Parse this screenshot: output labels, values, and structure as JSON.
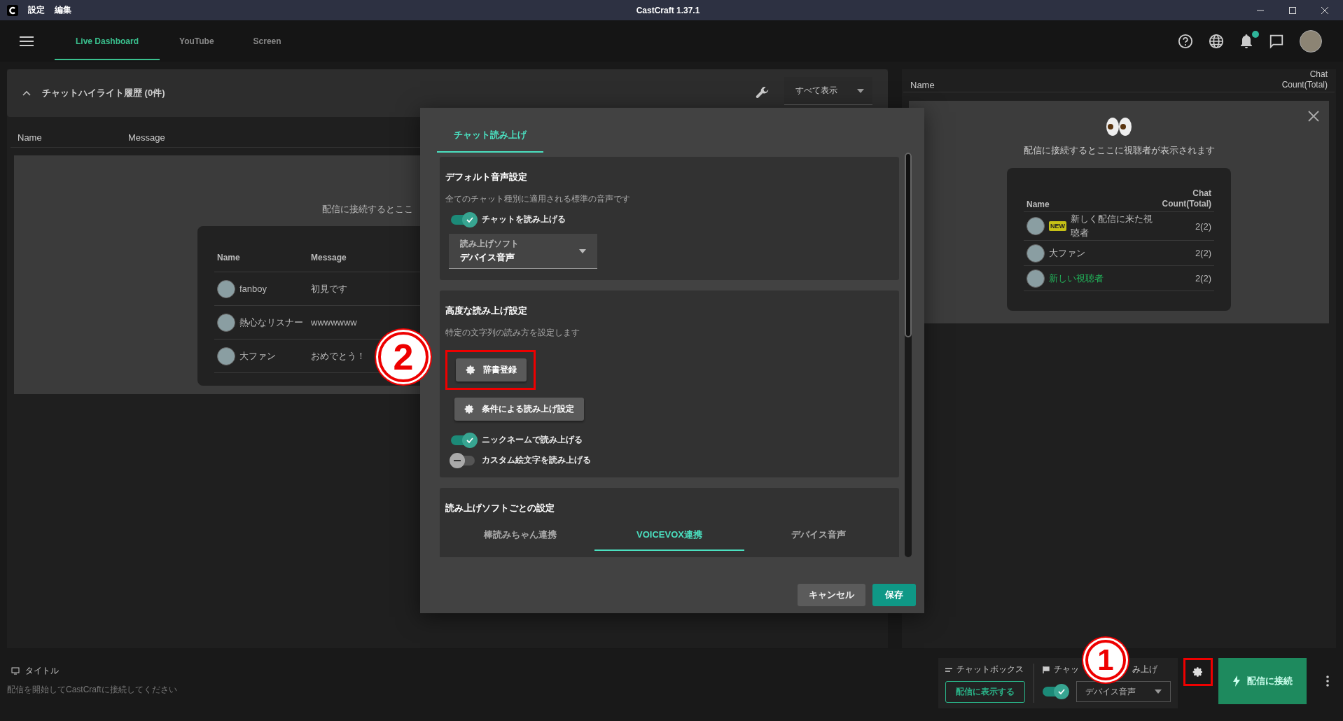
{
  "window": {
    "app_menu": [
      "設定",
      "編集"
    ],
    "title": "CastCraft 1.37.1"
  },
  "nav": {
    "tabs": [
      {
        "label": "Live Dashboard",
        "selected": true
      },
      {
        "label": "YouTube",
        "selected": false
      },
      {
        "label": "Screen",
        "selected": false
      }
    ],
    "notification_badge": true
  },
  "highlights": {
    "title": "チャットハイライト履歴 (0件)",
    "expanded": true,
    "filter": "すべて表示",
    "columns": [
      "Name",
      "Message"
    ],
    "empty_message": "配信に接続するとここ",
    "sample": {
      "columns": [
        "Name",
        "Message"
      ],
      "rows": [
        {
          "name": "fanboy",
          "message": "初見です"
        },
        {
          "name": "熱心なリスナー",
          "message": "wwwwwww"
        },
        {
          "name": "大ファン",
          "message": "おめでとう！"
        }
      ]
    }
  },
  "viewers": {
    "columns": [
      "Name",
      "Chat Count(Total)"
    ],
    "empty_message": "配信に接続するとここに視聴者が表示されます",
    "sample": {
      "columns": [
        "Name",
        "Chat Count(Total)"
      ],
      "rows": [
        {
          "name": "新しく配信に来た視聴者",
          "badge": "NEW",
          "highlighted": false,
          "count": "2(2)"
        },
        {
          "name": "大ファン",
          "highlighted": false,
          "count": "2(2)"
        },
        {
          "name": "新しい視聴者",
          "highlighted": true,
          "count": "2(2)"
        }
      ]
    }
  },
  "dialog": {
    "tabs": [
      {
        "label": "チャット読み上げ",
        "selected": true
      }
    ],
    "sections": [
      {
        "title": "デフォルト音声設定",
        "description": "全てのチャット種別に適用される標準の音声です",
        "items": [
          {
            "kind": "toggle",
            "label": "チャットを読み上げる",
            "on": true
          },
          {
            "kind": "select",
            "label": "読み上げソフト",
            "value": "デバイス音声"
          }
        ]
      },
      {
        "title": "高度な読み上げ設定",
        "description": "特定の文字列の読み方を設定します",
        "items": [
          {
            "kind": "button",
            "label": "辞書登録",
            "annotated": true
          },
          {
            "kind": "button",
            "label": "条件による読み上げ設定",
            "annotated": false
          },
          {
            "kind": "toggle",
            "label": "ニックネームで読み上げる",
            "on": true
          },
          {
            "kind": "toggle",
            "label": "カスタム絵文字を読み上げる",
            "on": false
          }
        ]
      },
      {
        "title": "読み上げソフトごとの設定",
        "items": [
          {
            "kind": "tabs",
            "tabs": [
              {
                "label": "棒読みちゃん連携",
                "selected": false
              },
              {
                "label": "VOICEVOX連携",
                "selected": true
              },
              {
                "label": "デバイス音声",
                "selected": false
              }
            ]
          }
        ]
      }
    ],
    "buttons": [
      {
        "label": "キャンセル",
        "kind": "secondary"
      },
      {
        "label": "保存",
        "kind": "primary"
      }
    ]
  },
  "stream": {
    "title_label": "タイトル",
    "hint": "配信を開始してCastCraftに接続してください"
  },
  "chat_box": {
    "label": "チャットボックス",
    "button": "配信に表示する"
  },
  "tts": {
    "label_parts": [
      "チャッ",
      "み上げ"
    ],
    "on": true,
    "value": "デバイス音声"
  },
  "connect_button": "配信に接続",
  "annotations": [
    {
      "number": "1"
    },
    {
      "number": "2"
    }
  ]
}
